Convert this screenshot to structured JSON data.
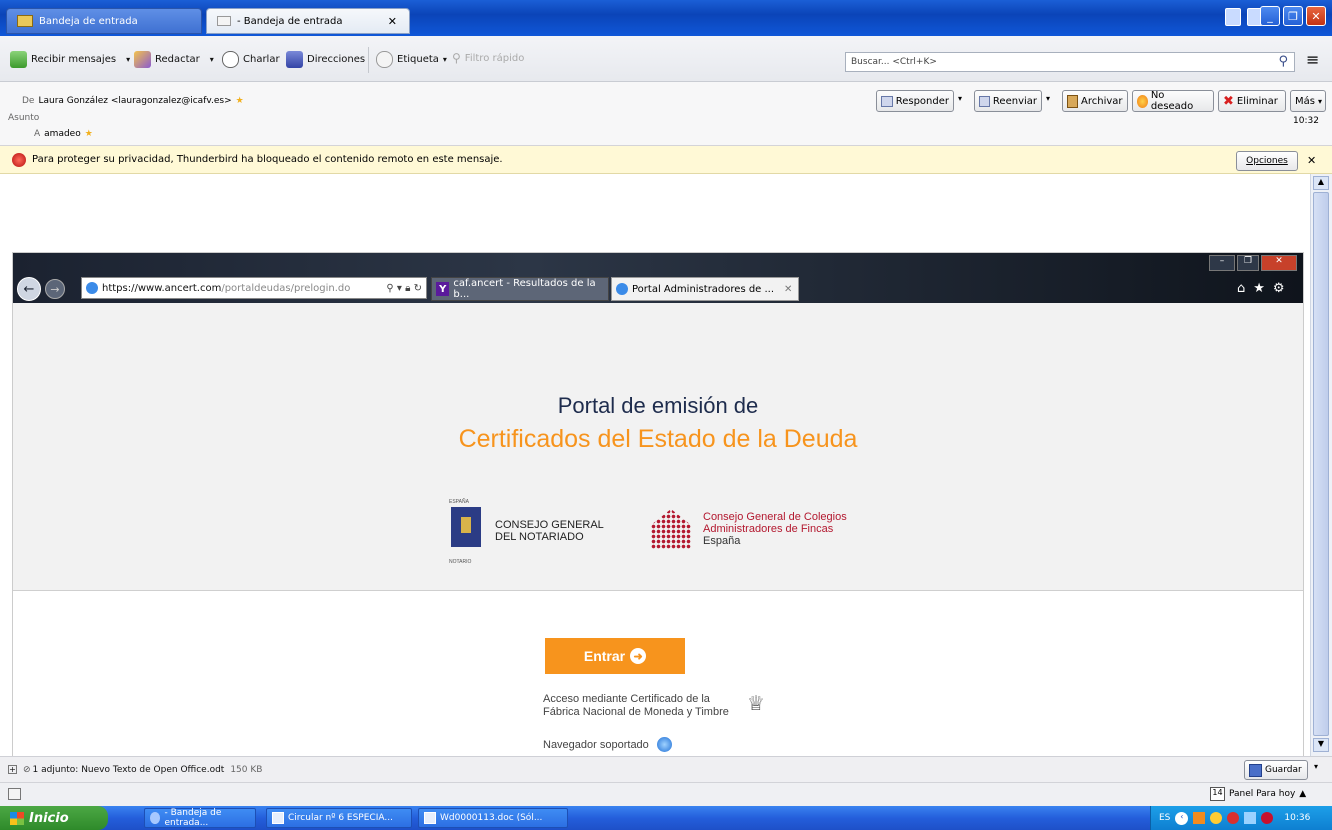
{
  "tabs": [
    {
      "label": "Bandeja de entrada"
    },
    {
      "label": "- Bandeja de entrada"
    }
  ],
  "toolbar": {
    "get_mail": "Recibir mensajes",
    "compose": "Redactar",
    "chat": "Charlar",
    "address_book": "Direcciones",
    "tag": "Etiqueta",
    "quick_filter": "Filtro rápido",
    "search_placeholder": "Buscar... <Ctrl+K>"
  },
  "message": {
    "from_label": "De",
    "from_value": "Laura González <lauragonzalez@icafv.es>",
    "subject_label": "Asunto",
    "to_label": "A",
    "to_value": "amadeo",
    "time": "10:32",
    "actions": {
      "reply": "Responder",
      "forward": "Reenviar",
      "archive": "Archivar",
      "junk": "No deseado",
      "delete": "Eliminar",
      "more": "Más"
    }
  },
  "notice": {
    "text": "Para proteger su privacidad, Thunderbird ha bloqueado el contenido remoto en este mensaje.",
    "options": "Opciones"
  },
  "browser": {
    "url_host": "https://www.ancert.com",
    "url_path": "/portaldeudas/prelogin.do",
    "tabs": [
      {
        "label": "caf.ancert - Resultados de la b..."
      },
      {
        "label": "Portal Administradores de ..."
      }
    ]
  },
  "portal": {
    "title_line1": "Portal de emisión de",
    "title_line2": "Certificados del Estado de la Deuda",
    "logo1_top": "ESPAÑA",
    "logo1_line1": "CONSEJO GENERAL",
    "logo1_line2": "DEL NOTARIADO",
    "logo1_caption": "NOTARIO",
    "logo2_line1": "Consejo General de Colegios",
    "logo2_line2": "Administradores de Fincas",
    "logo2_line3": "España",
    "enter_button": "Entrar",
    "cert_line1": "Acceso mediante Certificado de la",
    "cert_line2": "Fábrica Nacional de Moneda y Timbre",
    "supported": "Navegador soportado"
  },
  "attachment": {
    "text": "1 adjunto: Nuevo Texto de Open Office.odt",
    "size": "150 KB",
    "save": "Guardar"
  },
  "statusbar": {
    "today_panel": "Panel Para hoy",
    "today_day": "14"
  },
  "taskbar": {
    "start": "Inicio",
    "items": [
      {
        "label": "- Bandeja de entrada..."
      },
      {
        "label": "Circular nº 6 ESPECIA..."
      },
      {
        "label": "Wd0000113.doc (Sól..."
      }
    ],
    "lang": "ES",
    "clock": "10:36"
  }
}
